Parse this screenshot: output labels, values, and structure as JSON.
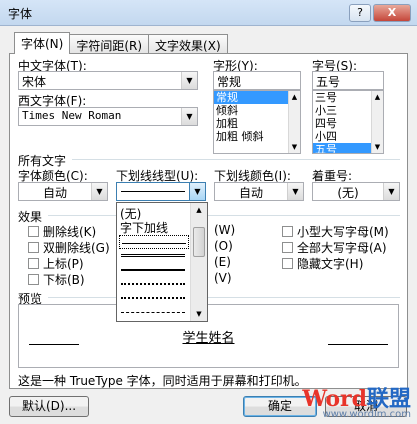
{
  "window": {
    "title": "字体",
    "help": "?",
    "close": "X"
  },
  "tabs": [
    "字体(N)",
    "字符间距(R)",
    "文字效果(X)"
  ],
  "font": {
    "chinese_label": "中文字体(T):",
    "chinese_value": "宋体",
    "western_label": "西文字体(F):",
    "western_value": "Times New Roman",
    "style_label": "字形(Y):",
    "style_value": "常规",
    "style_items": [
      "常规",
      "倾斜",
      "加粗",
      "加粗 倾斜"
    ],
    "size_label": "字号(S):",
    "size_value": "五号",
    "size_items": [
      "三号",
      "小三",
      "四号",
      "小四",
      "五号"
    ]
  },
  "all_text": {
    "heading": "所有文字",
    "color_label": "字体颜色(C):",
    "color_value": "自动",
    "underline_label": "下划线线型(U):",
    "underline_color_label": "下划线颜色(I):",
    "underline_color_value": "自动",
    "emphasis_label": "着重号:",
    "emphasis_value": "(无)"
  },
  "underline_dropdown": {
    "items": [
      "(无)",
      "字下加线"
    ]
  },
  "effects": {
    "heading": "效果",
    "left": [
      "删除线(K)",
      "双删除线(G)",
      "上标(P)",
      "下标(B)"
    ],
    "middle": [
      "(W)",
      "(O)",
      "(E)",
      "(V)"
    ],
    "right": [
      "小型大写字母(M)",
      "全部大写字母(A)",
      "隐藏文字(H)"
    ]
  },
  "preview": {
    "heading": "预览",
    "sample": "学生姓名"
  },
  "description": "这是一种 TrueType 字体，同时适用于屏幕和打印机。",
  "buttons": {
    "default": "默认(D)...",
    "ok": "确定",
    "cancel": "取消"
  },
  "watermark": {
    "main_red": "Word",
    "main_blue": "联盟",
    "url": "www.wordlm.com"
  }
}
